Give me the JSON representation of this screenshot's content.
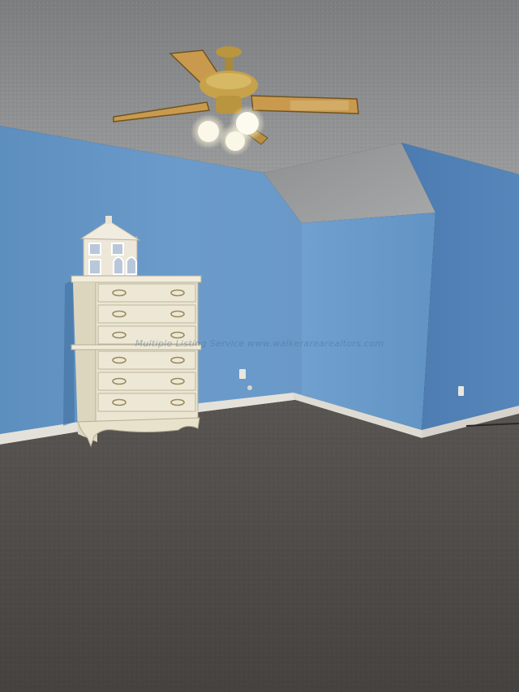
{
  "scene": {
    "type": "photo",
    "subject": "empty carpeted bedroom with sloped ceiling",
    "colors": {
      "wall_left": "#5e8fbf",
      "wall_center": "#6d9ccb",
      "wall_right": "#4e7fb3",
      "ceiling": "#8a8b8c",
      "carpet": "#4e4a48",
      "baseboard": "#e6e3dc",
      "dresser": "#e9e3cf",
      "fan_blade": "#c99a4e",
      "fan_brass": "#b9953f"
    }
  },
  "watermark": {
    "text": "Multiple Listing Service  www.walkerarearealtors.com"
  },
  "objects": [
    {
      "name": "ceiling-fan",
      "icon": "ceiling-fan-icon"
    },
    {
      "name": "dresser",
      "drawers": 6
    },
    {
      "name": "dollhouse-ornament"
    },
    {
      "name": "wall-outlet"
    }
  ]
}
